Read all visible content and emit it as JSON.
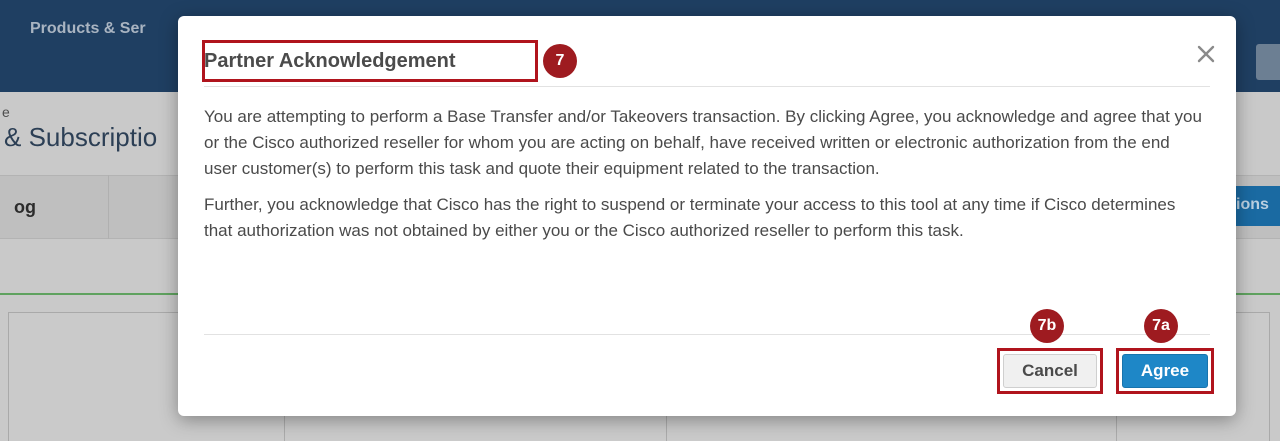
{
  "background": {
    "nav_label": "Products & Ser",
    "breadcrumb": "e",
    "page_title": "& Subscriptio",
    "tab_label": "og",
    "tab_right_label": "ions"
  },
  "modal": {
    "title": "Partner Acknowledgement",
    "close_symbol": "×",
    "paragraphs": [
      "You are attempting to perform a Base Transfer and/or Takeovers transaction. By clicking Agree, you acknowledge and agree that you or the Cisco authorized reseller for whom you are acting on behalf, have received written or electronic authorization from the end user customer(s) to perform this task and quote their equipment related to the transaction.",
      "Further, you acknowledge that Cisco has the right to suspend or terminate your access to this tool at any time if Cisco determines that authorization was not obtained by either you or the Cisco authorized reseller to perform this task."
    ],
    "cancel_label": "Cancel",
    "agree_label": "Agree"
  },
  "callouts": {
    "title": "7",
    "cancel": "7b",
    "agree": "7a"
  },
  "colors": {
    "accent_blue": "#1e87c7",
    "callout_red": "#9e1b20",
    "header_navy": "#1f3f62"
  },
  "icons": {
    "close": "close-icon"
  }
}
